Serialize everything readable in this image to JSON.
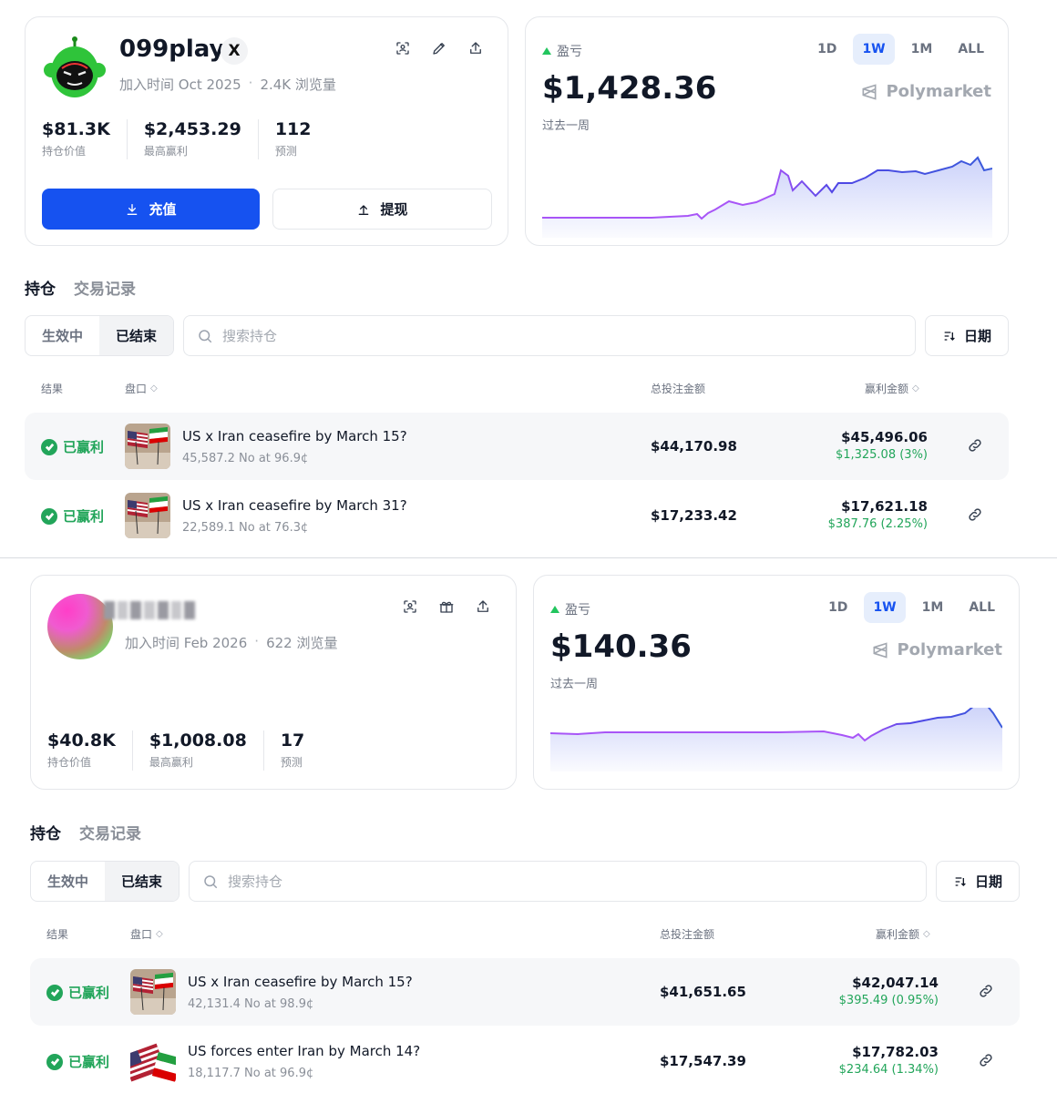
{
  "panel1": {
    "profile": {
      "name": "099play",
      "x_badge": "X",
      "joined": "加入时间 Oct 2025",
      "views": "2.4K 浏览量",
      "icons": [
        "scan-icon",
        "pencil-icon",
        "share-icon"
      ],
      "stats": [
        {
          "value": "$81.3K",
          "label": "持仓价值"
        },
        {
          "value": "$2,453.29",
          "label": "最高赢利"
        },
        {
          "value": "112",
          "label": "预测"
        }
      ],
      "deposit_label": "充值",
      "withdraw_label": "提现"
    },
    "pnl": {
      "label": "盈亏",
      "value": "$1,428.36",
      "period": "过去一周",
      "ranges": [
        "1D",
        "1W",
        "1M",
        "ALL"
      ],
      "active_range": "1W",
      "brand": "Polymarket"
    },
    "tabs": [
      "持仓",
      "交易记录"
    ],
    "segments": [
      "生效中",
      "已结束"
    ],
    "search_placeholder": "搜索持仓",
    "sort_label": "日期",
    "headers": {
      "result": "结果",
      "market": "盘口",
      "total_bet": "总投注金额",
      "winnings": "赢利金额"
    },
    "rows": [
      {
        "status": "已赢利",
        "title": "US x Iran ceasefire by March 15?",
        "sub": "45,587.2 No at 96.9¢",
        "total": "$44,170.98",
        "win": "$45,496.06",
        "gain": "$1,325.08 (3%)",
        "thumb": "flags"
      },
      {
        "status": "已赢利",
        "title": "US x Iran ceasefire by March 31?",
        "sub": "22,589.1 No at 76.3¢",
        "total": "$17,233.42",
        "win": "$17,621.18",
        "gain": "$387.76 (2.25%)",
        "thumb": "flags"
      }
    ]
  },
  "panel2": {
    "profile": {
      "joined": "加入时间 Feb 2026",
      "views": "622 浏览量",
      "icons": [
        "scan-icon",
        "gift-icon",
        "share-icon"
      ],
      "stats": [
        {
          "value": "$40.8K",
          "label": "持仓价值"
        },
        {
          "value": "$1,008.08",
          "label": "最高赢利"
        },
        {
          "value": "17",
          "label": "预测"
        }
      ]
    },
    "pnl": {
      "label": "盈亏",
      "value": "$140.36",
      "period": "过去一周",
      "ranges": [
        "1D",
        "1W",
        "1M",
        "ALL"
      ],
      "active_range": "1W",
      "brand": "Polymarket"
    },
    "tabs": [
      "持仓",
      "交易记录"
    ],
    "segments": [
      "生效中",
      "已结束"
    ],
    "search_placeholder": "搜索持仓",
    "sort_label": "日期",
    "headers": {
      "result": "结果",
      "market": "盘口",
      "total_bet": "总投注金额",
      "winnings": "赢利金额"
    },
    "rows": [
      {
        "status": "已赢利",
        "title": "US x Iran ceasefire by March 15?",
        "sub": "42,131.4 No at 98.9¢",
        "total": "$41,651.65",
        "win": "$42,047.14",
        "gain": "$395.49 (0.95%)",
        "thumb": "flags"
      },
      {
        "status": "已赢利",
        "title": "US forces enter Iran by March 14?",
        "sub": "18,117.7 No at 96.9¢",
        "total": "$17,547.39",
        "win": "$17,782.03",
        "gain": "$234.64 (1.34%)",
        "thumb": "usflag-iran"
      }
    ]
  },
  "colors": {
    "primary": "#1652f0",
    "success": "#22a55a",
    "chart_line_start": "#a855f7",
    "chart_line_end": "#3b5bdb",
    "avatar_green": "#22c52e"
  }
}
